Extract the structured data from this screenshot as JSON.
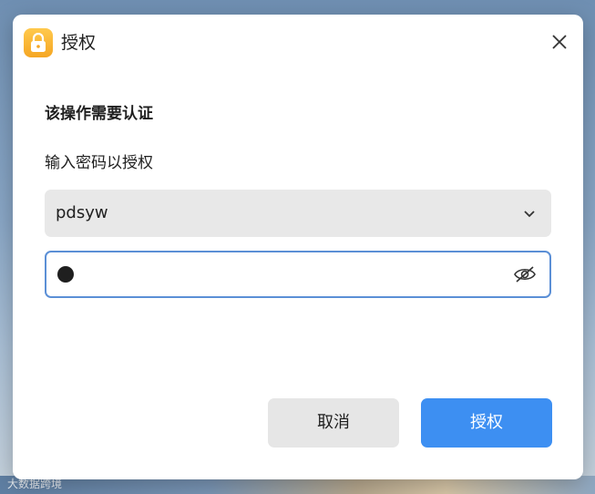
{
  "dialog": {
    "title": "授权",
    "icon": "lock-icon",
    "heading": "该操作需要认证",
    "subheading": "输入密码以授权",
    "user": {
      "selected": "pdsyw"
    },
    "password": {
      "mask": "●"
    },
    "buttons": {
      "cancel_label": "取消",
      "ok_label": "授权"
    }
  },
  "watermark": "大数据跨境",
  "colors": {
    "accent": "#3d8ff2",
    "focus_border": "#5b8fd6",
    "icon_yellow": "#f5a623"
  }
}
